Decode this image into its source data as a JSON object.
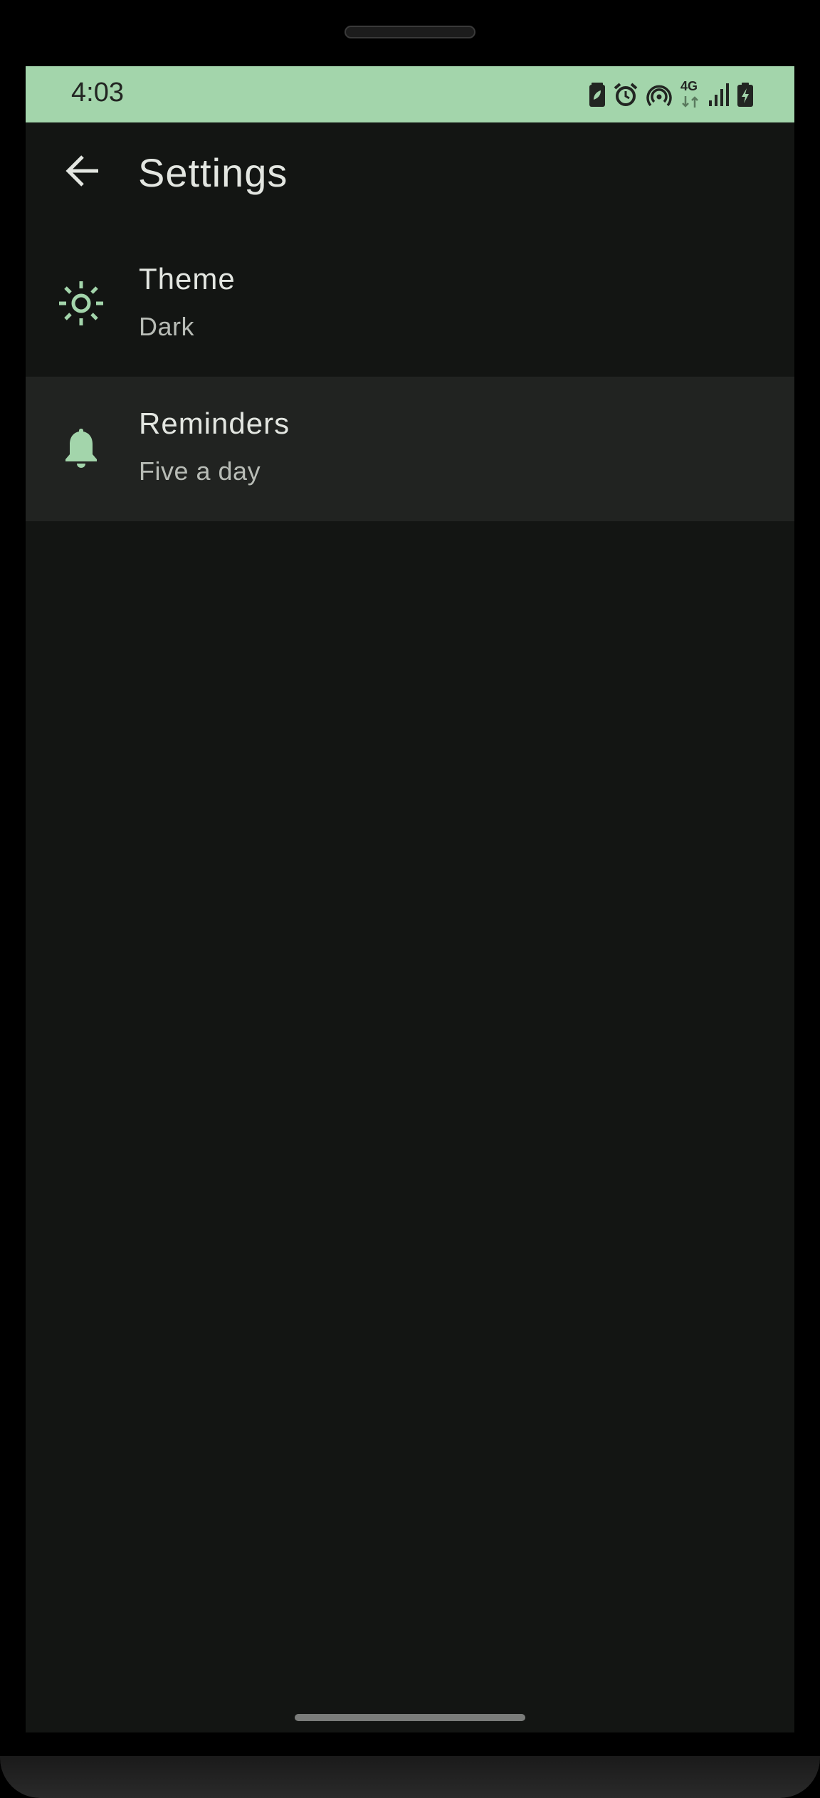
{
  "status_bar": {
    "time": "4:03",
    "network_label": "4G",
    "icons": [
      "battery-saver-icon",
      "alarm-icon",
      "hotspot-icon",
      "network-4g-icon",
      "signal-icon",
      "battery-charging-icon"
    ]
  },
  "app_bar": {
    "back_icon": "arrow-back-icon",
    "title": "Settings"
  },
  "settings": {
    "items": [
      {
        "icon": "sun-icon",
        "title": "Theme",
        "subtitle": "Dark"
      },
      {
        "icon": "bell-icon",
        "title": "Reminders",
        "subtitle": "Five a day"
      }
    ]
  },
  "colors": {
    "accent": "#a3d5ab",
    "background": "#131513",
    "highlight": "#212321",
    "text_primary": "#e3e6e1",
    "text_secondary": "#b8bcb6"
  }
}
